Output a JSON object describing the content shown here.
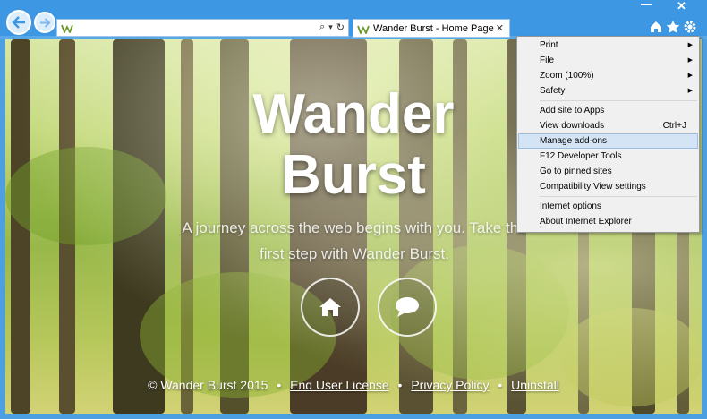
{
  "browser": {
    "tab_title": "Wander Burst - Home Page",
    "tab_close": "✕",
    "address_value": "",
    "search_glyph": "⌕",
    "dropdown_glyph": "▾",
    "refresh_glyph": "↻",
    "window_close": "✕"
  },
  "hero": {
    "title_line1": "Wander",
    "title_line2": "Burst",
    "subtitle_line1": "A journey across the web begins with you. Take the",
    "subtitle_line2": "first step with Wander Burst."
  },
  "footer": {
    "copyright": "© Wander Burst 2015",
    "bullet": "•",
    "eula": "End User License",
    "privacy": "Privacy Policy",
    "uninstall": "Uninstall"
  },
  "tools_menu": {
    "print": "Print",
    "file": "File",
    "zoom": "Zoom (100%)",
    "safety": "Safety",
    "add_site": "Add site to Apps",
    "view_downloads": "View downloads",
    "view_downloads_shortcut": "Ctrl+J",
    "manage_addons": "Manage add-ons",
    "f12": "F12 Developer Tools",
    "pinned": "Go to pinned sites",
    "compat": "Compatibility View settings",
    "internet_options": "Internet options",
    "about": "About Internet Explorer",
    "submenu_arrow": "▶"
  },
  "colors": {
    "chrome_blue": "#3d97e3",
    "menu_highlight": "#d5e4f5"
  }
}
